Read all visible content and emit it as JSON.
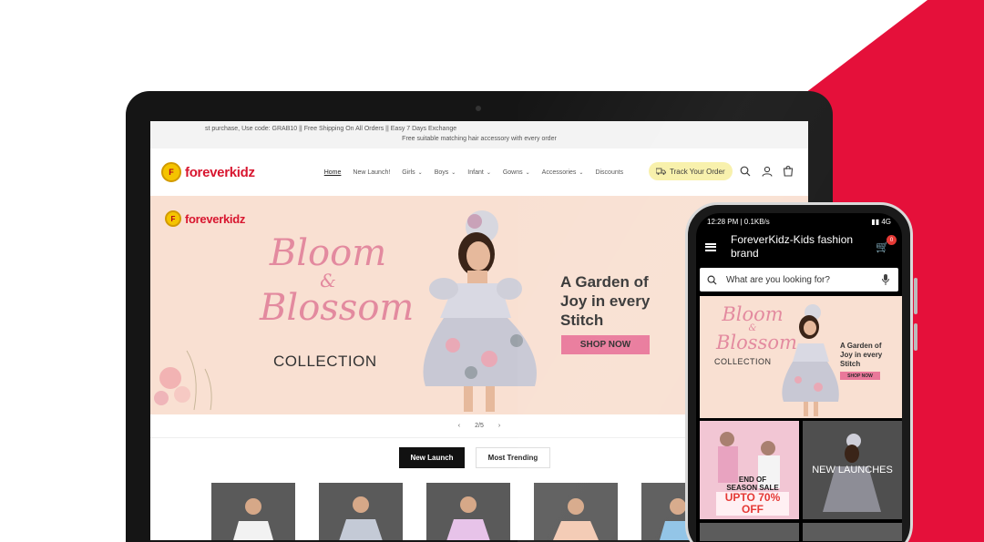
{
  "colors": {
    "brand_red": "#d8162f",
    "shop_pink": "#e9789a",
    "hero_bg": "#f9e0d2",
    "track_yellow": "#f8f0a8"
  },
  "announcement": {
    "line1": "st purchase, Use code: GRAB10 || Free Shipping On All Orders || Easy 7 Days Exchange",
    "line2": "Free suitable matching hair accessory with every order"
  },
  "header": {
    "logo": "foreverkidz",
    "nav": [
      {
        "label": "Home"
      },
      {
        "label": "New Launch!"
      },
      {
        "label": "Girls"
      },
      {
        "label": "Boys"
      },
      {
        "label": "Infant"
      },
      {
        "label": "Gowns"
      },
      {
        "label": "Accessories"
      },
      {
        "label": "Discounts"
      }
    ],
    "track_order": "Track Your Order",
    "icons": [
      "search-icon",
      "account-icon",
      "cart-icon"
    ]
  },
  "hero": {
    "logo": "foreverkidz",
    "title_line1": "Bloom",
    "title_amp": "&",
    "title_line2": "Blossom",
    "collection": "COLLECTION",
    "tagline_line1": "A Garden of",
    "tagline_line2": "Joy in every",
    "tagline_line3": "Stitch",
    "cta": "SHOP NOW"
  },
  "slider": {
    "page": "2/5",
    "prev": "‹",
    "next": "›"
  },
  "tabs": {
    "new_launch": "New Launch",
    "most_trending": "Most Trending"
  },
  "phone": {
    "status_left": "12:28 PM | 0.1KB/s",
    "status_right": "▮▮ 4G",
    "app_title": "ForeverKidz-Kids fashion brand",
    "cart_count": "0",
    "search_placeholder": "What are you looking for?",
    "banner": {
      "title_line1": "Bloom",
      "title_amp": "&",
      "title_line2": "Blossom",
      "collection": "COLLECTION",
      "tagline_line1": "A Garden of",
      "tagline_line2": "Joy in every",
      "tagline_line3": "Stitch",
      "cta": "SHOP NOW"
    },
    "tiles": {
      "sale_line1": "END OF",
      "sale_line2": "SEASON SALE",
      "sale_big": "UPTO 70% OFF",
      "new_launches": "NEW LAUNCHES"
    }
  }
}
